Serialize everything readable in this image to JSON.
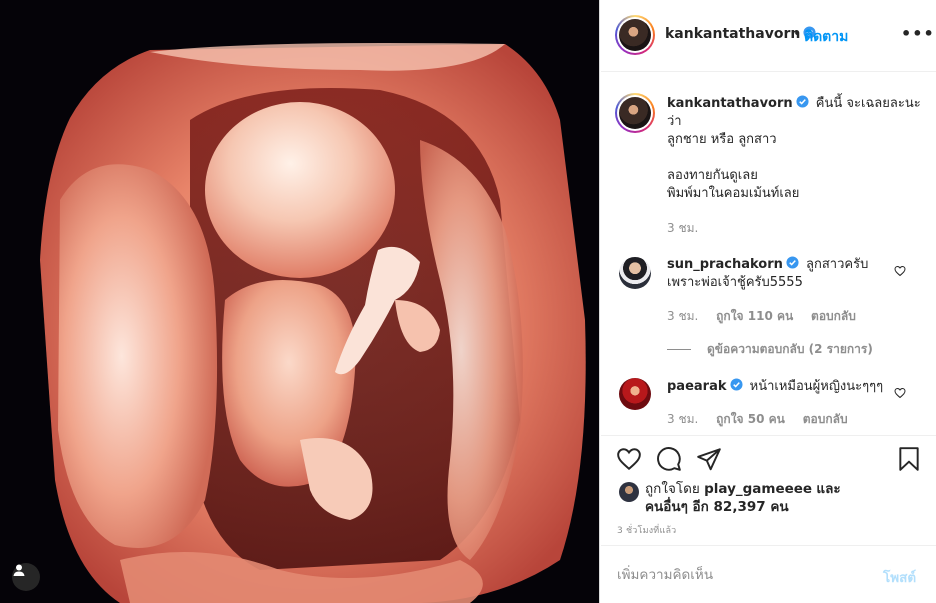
{
  "post": {
    "username": "kankantathavorn",
    "follow_label": "ติดตาม",
    "dot": "•",
    "more_label": "•••"
  },
  "caption": {
    "username": "kankantathavorn",
    "line1": "คืนนี้ จะเฉลยละนะ",
    "line2": "ว่า",
    "line3": "ลูกชาย หรือ ลูกสาว",
    "line4": "ลองทายกันดูเลย",
    "line5": "พิมพ์มาในคอมเม้นท์เลย",
    "time": "3 ชม."
  },
  "comments": [
    {
      "username": "sun_prachakorn",
      "text_line1": "ลูกสาวครับ",
      "text_line2": "เพราะพ่อเจ้าชู้ครับ5555",
      "time": "3 ชม.",
      "likes": "ถูกใจ 110 คน",
      "reply": "ตอบกลับ"
    },
    {
      "username": "paearak",
      "text_line1": "หน้าเหมือนผู้หญิงนะๆๆๆ",
      "time": "3 ชม.",
      "likes": "ถูกใจ 50 คน",
      "reply": "ตอบกลับ"
    }
  ],
  "view_replies": "ดูข้อความตอบกลับ (2 รายการ)",
  "likes": {
    "prefix": "ถูกใจโดย",
    "user": "play_gameeee",
    "and": "และ",
    "others": "คนอื่นๆ อีก 82,397 คน"
  },
  "time_ago": "3 ชั่วโมงที่แล้ว",
  "add_comment": {
    "placeholder": "เพิ่มความคิดเห็น",
    "post_label": "โพสต์"
  },
  "colors": {
    "accent": "#0095f6",
    "post_disabled": "#b2dffc",
    "verified": "#3897f0"
  },
  "icons": [
    "user-tag-icon",
    "verified-icon",
    "more-icon",
    "heart-icon",
    "comment-icon",
    "share-icon",
    "bookmark-icon"
  ]
}
